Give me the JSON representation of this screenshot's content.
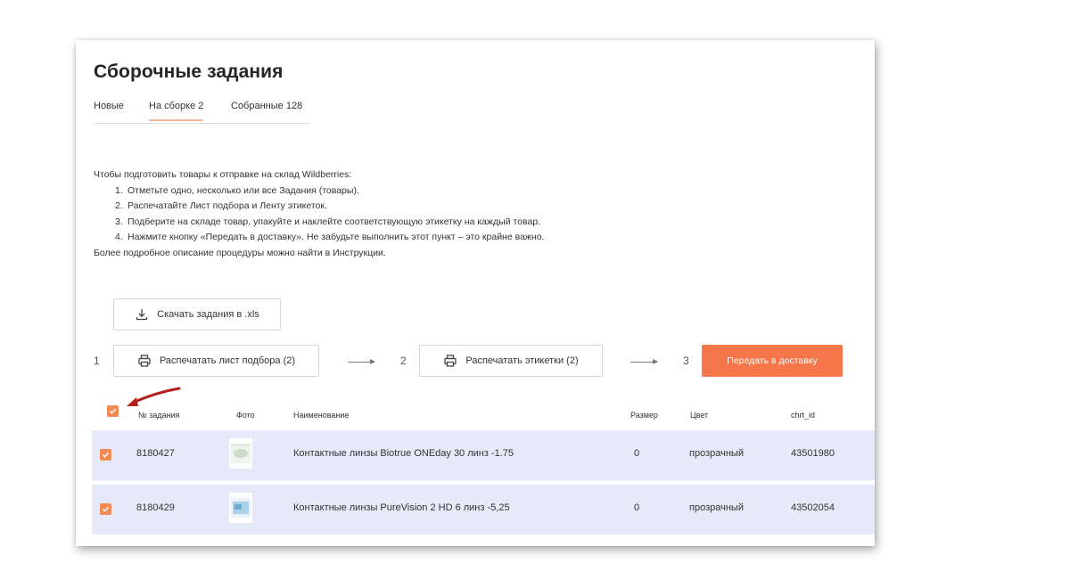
{
  "page": {
    "title": "Сборочные задания"
  },
  "tabs": [
    {
      "label": "Новые",
      "active": false
    },
    {
      "label": "На сборке 2",
      "active": true
    },
    {
      "label": "Собранные 128",
      "active": false
    }
  ],
  "instructions": {
    "intro": "Чтобы подготовить товары к отправке на склад Wildberries:",
    "steps": [
      "Отметьте одно, несколько или все Задания (товары).",
      "Распечатайте Лист подбора и Ленту этикеток.",
      "Подберите на складе товар, упакуйте и наклейте соответствующую этикетку на каждый товар.",
      "Нажмите кнопку «Передать в доставку». Не забудьте выполнить этот пункт – это крайне важно."
    ],
    "footer": "Более подробное описание процедуры можно найти в Инструкции."
  },
  "actions": {
    "download_label": "Скачать задания в .xls",
    "step1": "1",
    "step2": "2",
    "step3": "3",
    "print_list_label": "Распечатать лист подбора (2)",
    "print_labels_label": "Распечатать этикетки (2)",
    "deliver_label": "Передать в доставку"
  },
  "table": {
    "columns": [
      "№ задания",
      "Фото",
      "Наименование",
      "Размер",
      "Цвет",
      "chrt_id"
    ],
    "rows": [
      {
        "id": "8180427",
        "name": "Контактные линзы Biotrue ONEday 30 линз -1.75",
        "size": "0",
        "color": "прозрачный",
        "chrt_id": "43501980",
        "checked": true
      },
      {
        "id": "8180429",
        "name": "Контактные линзы PureVision 2 HD 6 линз -5,25",
        "size": "0",
        "color": "прозрачный",
        "chrt_id": "43502054",
        "checked": true
      }
    ],
    "all_checked": true
  },
  "colors": {
    "accent": "#f4764a",
    "checkbox": "#f18a55",
    "row_highlight": "#e6e9f7",
    "annotation_arrow": "#b51f1f"
  }
}
